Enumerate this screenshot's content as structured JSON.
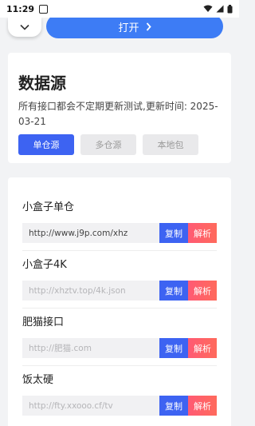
{
  "status": {
    "time": "11:29"
  },
  "header": {
    "open_label": "打开"
  },
  "source_card": {
    "title": "数据源",
    "description": "所有接口都会不定期更新测试,更新时间: 2025-03-21",
    "tabs": [
      {
        "label": "单仓源"
      },
      {
        "label": "多仓源"
      },
      {
        "label": "本地包"
      }
    ]
  },
  "sources": [
    {
      "name": "小盒子单仓",
      "url": "http://www.j9p.com/xhz",
      "copy_label": "复制",
      "parse_label": "解析"
    },
    {
      "name": "小盒子4K",
      "url": "http://xhztv.top/4k.json",
      "copy_label": "复制",
      "parse_label": "解析"
    },
    {
      "name": "肥猫接口",
      "url": "http://肥猫.com",
      "copy_label": "复制",
      "parse_label": "解析"
    },
    {
      "name": "饭太硬",
      "url": "http://fty.xxooo.cf/tv",
      "copy_label": "复制",
      "parse_label": "解析"
    }
  ],
  "colors": {
    "primary": "#3d63f2",
    "open_button": "#3d7cf5",
    "parse": "#ff5a74"
  }
}
